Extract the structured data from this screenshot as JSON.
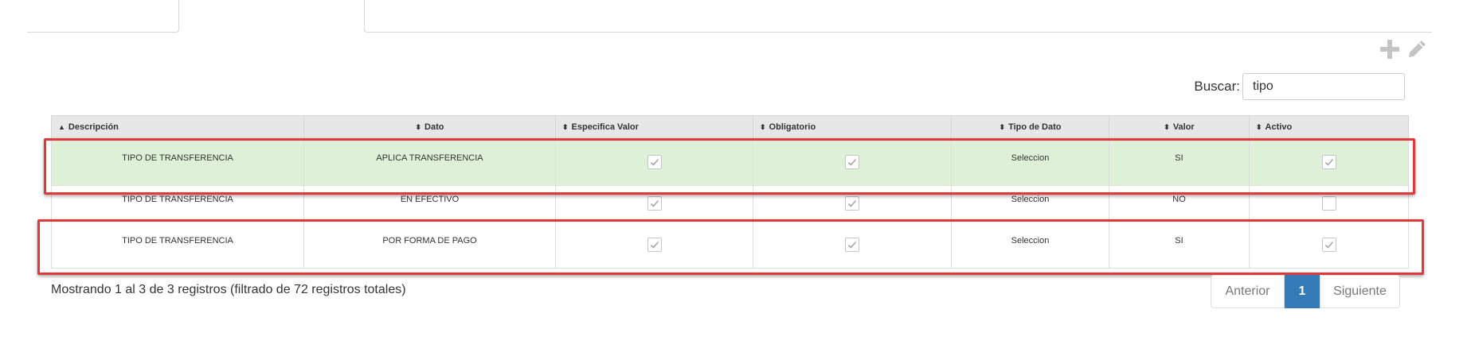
{
  "toolbar": {
    "add_icon": "plus-icon",
    "edit_icon": "pencil-icon"
  },
  "search": {
    "label": "Buscar:",
    "value": "tipo"
  },
  "table": {
    "headers": [
      "Descripción",
      "Dato",
      "Especifica Valor",
      "Obligatorio",
      "Tipo de Dato",
      "Valor",
      "Activo"
    ],
    "rows": [
      {
        "descripcion": "TIPO DE TRANSFERENCIA",
        "dato": "APLICA TRANSFERENCIA",
        "especifica_valor": true,
        "obligatorio": true,
        "tipo_dato": "Seleccion",
        "valor": "SI",
        "activo": true
      },
      {
        "descripcion": "TIPO DE TRANSFERENCIA",
        "dato": "EN EFECTIVO",
        "especifica_valor": true,
        "obligatorio": true,
        "tipo_dato": "Seleccion",
        "valor": "NO",
        "activo": false
      },
      {
        "descripcion": "TIPO DE TRANSFERENCIA",
        "dato": "POR FORMA DE PAGO",
        "especifica_valor": true,
        "obligatorio": true,
        "tipo_dato": "Seleccion",
        "valor": "SI",
        "activo": true
      }
    ]
  },
  "footer": {
    "info": "Mostrando 1 al 3 de 3 registros (filtrado de 72 registros totales)"
  },
  "pagination": {
    "previous": "Anterior",
    "current": "1",
    "next": "Siguiente"
  },
  "colors": {
    "selected_row": "#dff0d8",
    "highlight_box": "#e0393b",
    "active_page": "#337ab7"
  }
}
